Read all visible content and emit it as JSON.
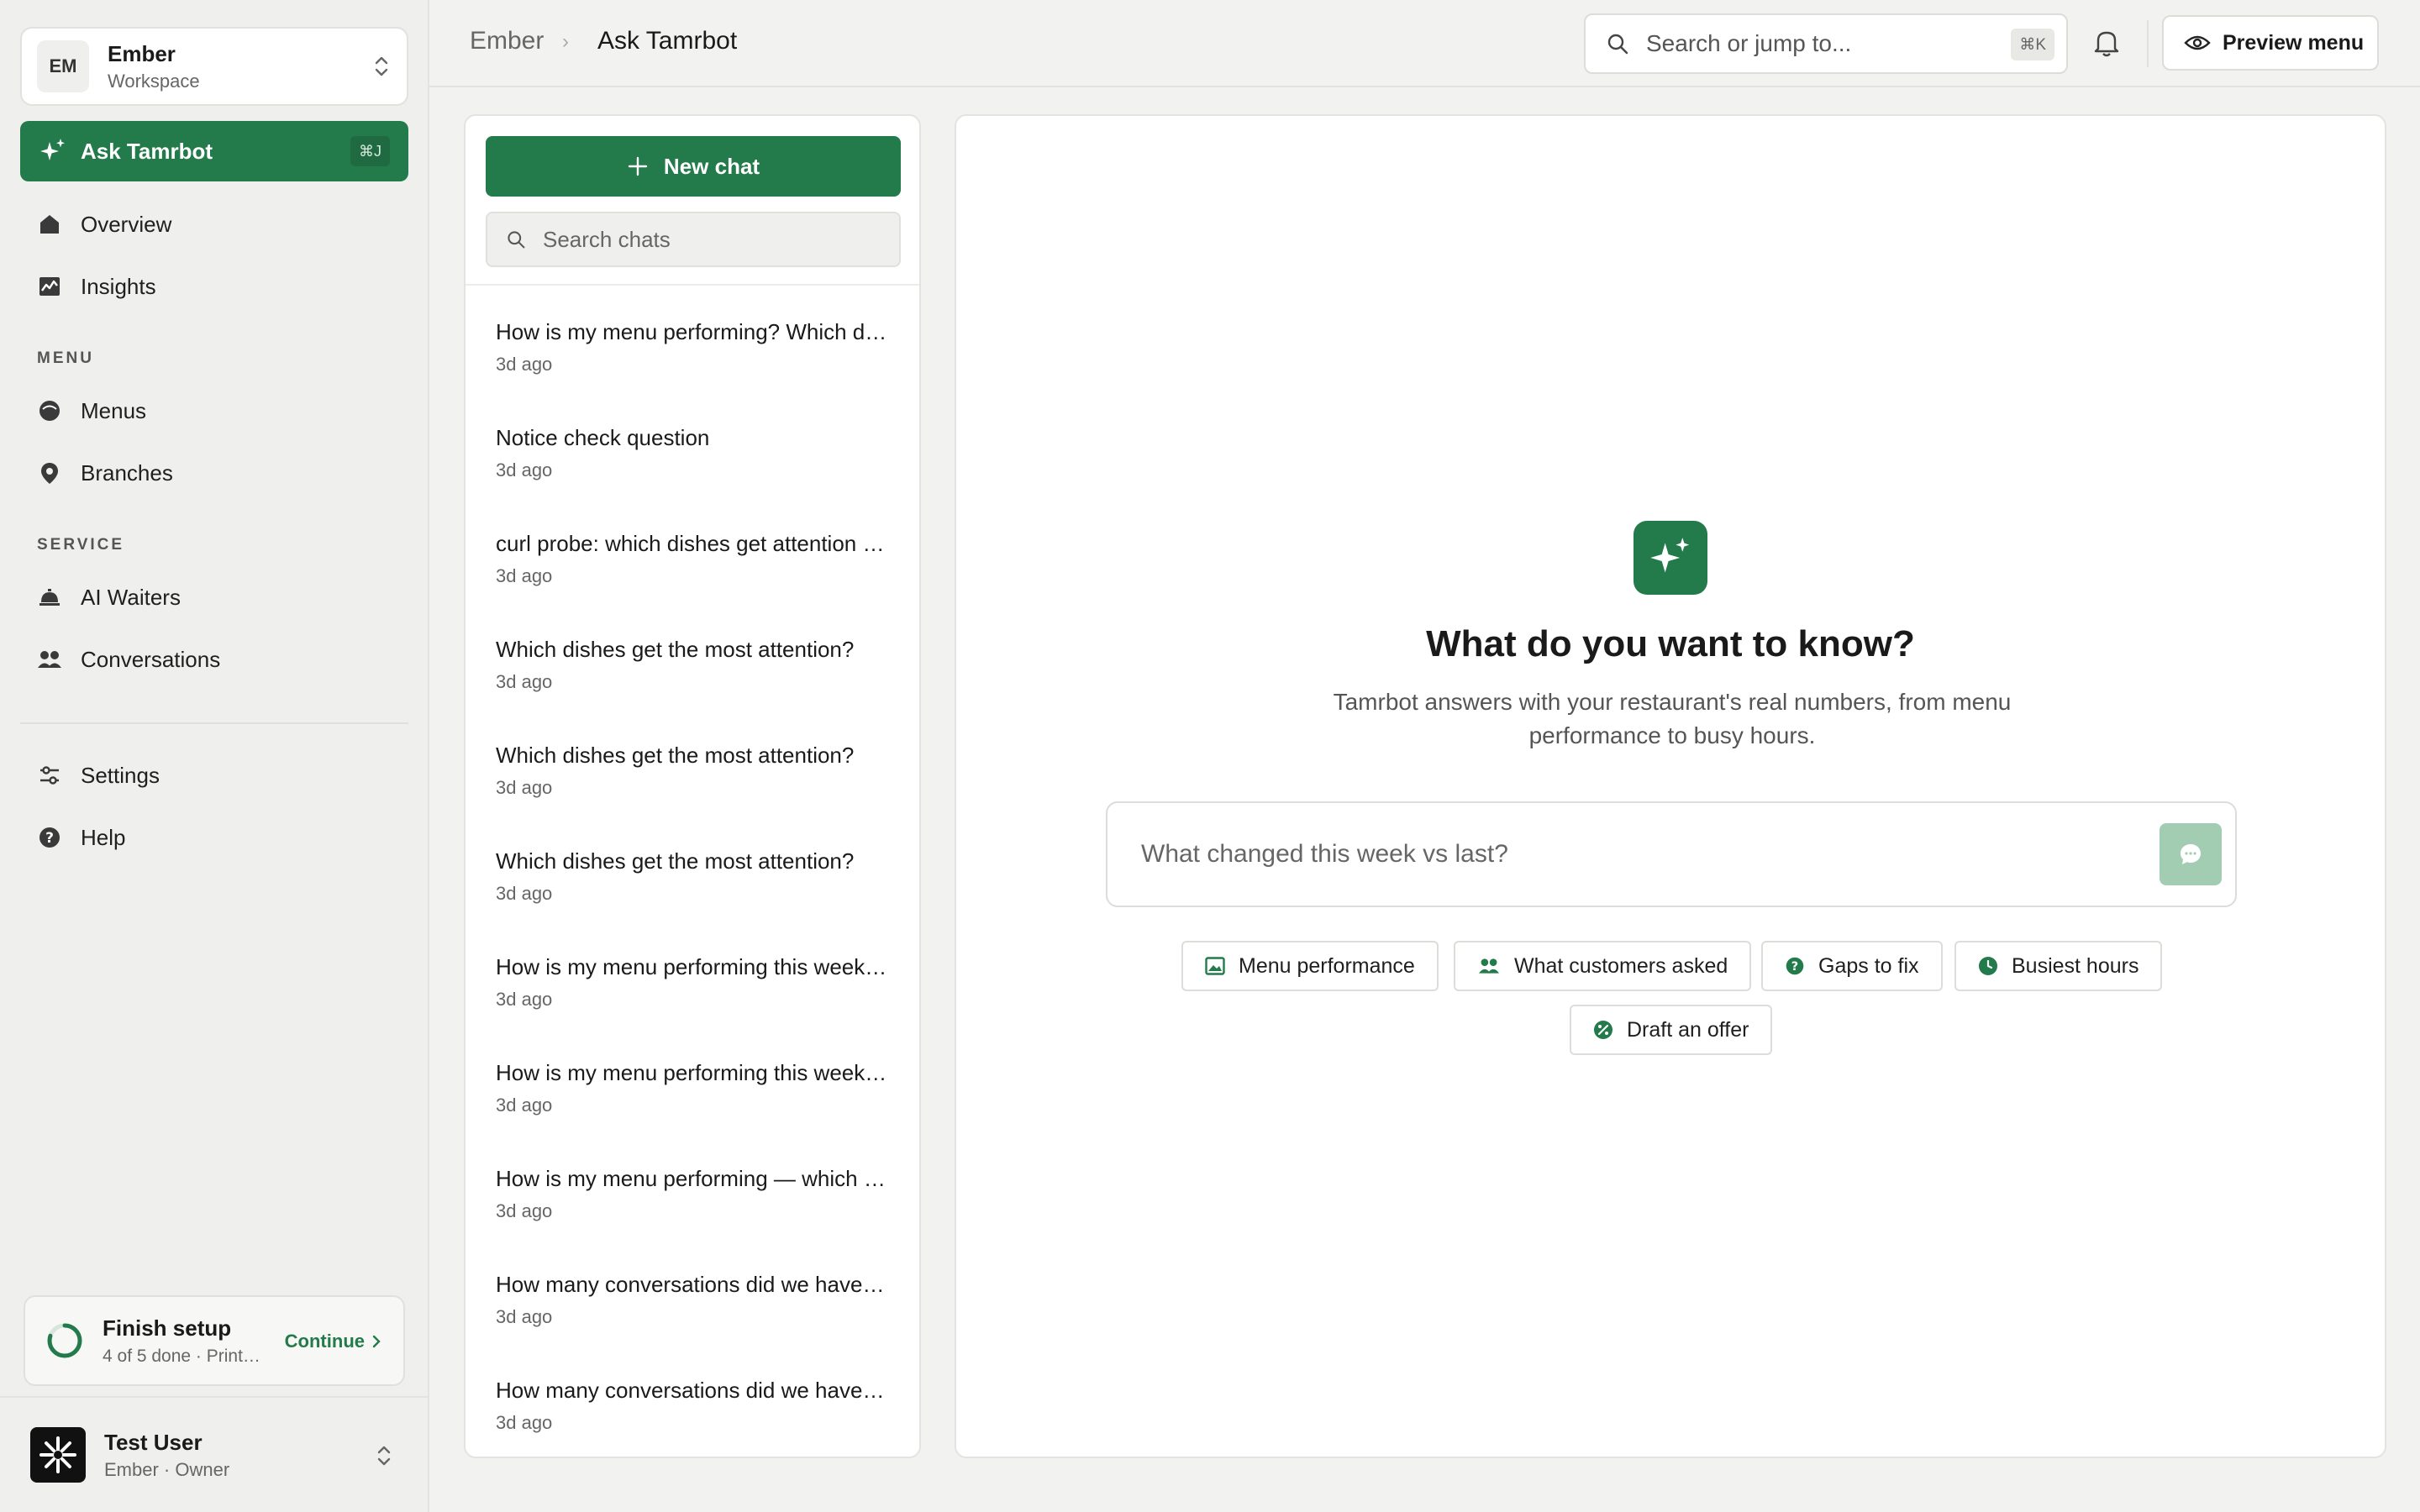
{
  "workspace": {
    "initials": "EM",
    "name": "Ember",
    "subtitle": "Workspace"
  },
  "ask": {
    "label": "Ask Tamrbot",
    "shortcut": "⌘J"
  },
  "nav": {
    "overview": "Overview",
    "insights": "Insights",
    "menu_section": "MENU",
    "menus": "Menus",
    "branches": "Branches",
    "service_section": "SERVICE",
    "ai_waiters": "AI Waiters",
    "conversations": "Conversations",
    "settings": "Settings",
    "help": "Help"
  },
  "setup": {
    "title": "Finish setup",
    "subtitle": "4 of 5 done · Print…",
    "continue": "Continue",
    "progress": 0.8
  },
  "user": {
    "name": "Test User",
    "subtitle": "Ember · Owner"
  },
  "breadcrumb": {
    "root": "Ember",
    "current": "Ask Tamrbot"
  },
  "search": {
    "placeholder": "Search or jump to...",
    "shortcut": "⌘K"
  },
  "preview": {
    "label": "Preview menu"
  },
  "chats": {
    "new_chat": "New chat",
    "search_placeholder": "Search chats",
    "items": [
      {
        "title": "How is my menu performing? Which dishes get the most attention?",
        "time": "3d ago"
      },
      {
        "title": "Notice check question",
        "time": "3d ago"
      },
      {
        "title": "curl probe: which dishes get attention this week?",
        "time": "3d ago"
      },
      {
        "title": "Which dishes get the most attention?",
        "time": "3d ago"
      },
      {
        "title": "Which dishes get the most attention?",
        "time": "3d ago"
      },
      {
        "title": "Which dishes get the most attention?",
        "time": "3d ago"
      },
      {
        "title": "How is my menu performing this week compared to last?",
        "time": "3d ago"
      },
      {
        "title": "How is my menu performing this week compared to last?",
        "time": "3d ago"
      },
      {
        "title": "How is my menu performing — which dishes stand out?",
        "time": "3d ago"
      },
      {
        "title": "How many conversations did we have this week?",
        "time": "3d ago"
      },
      {
        "title": "How many conversations did we have this week?",
        "time": "3d ago"
      }
    ]
  },
  "hero": {
    "title": "What do you want to know?",
    "subtitle": "Tamrbot answers with your restaurant's real numbers, from menu performance to busy hours.",
    "prompt_placeholder": "What changed this week vs last?"
  },
  "suggestions": {
    "menu_performance": "Menu performance",
    "customers_asked": "What customers asked",
    "gaps": "Gaps to fix",
    "busiest_hours": "Busiest hours",
    "draft_offer": "Draft an offer"
  },
  "colors": {
    "brand": "#237a4a",
    "send_disabled": "#a3cdb3"
  }
}
